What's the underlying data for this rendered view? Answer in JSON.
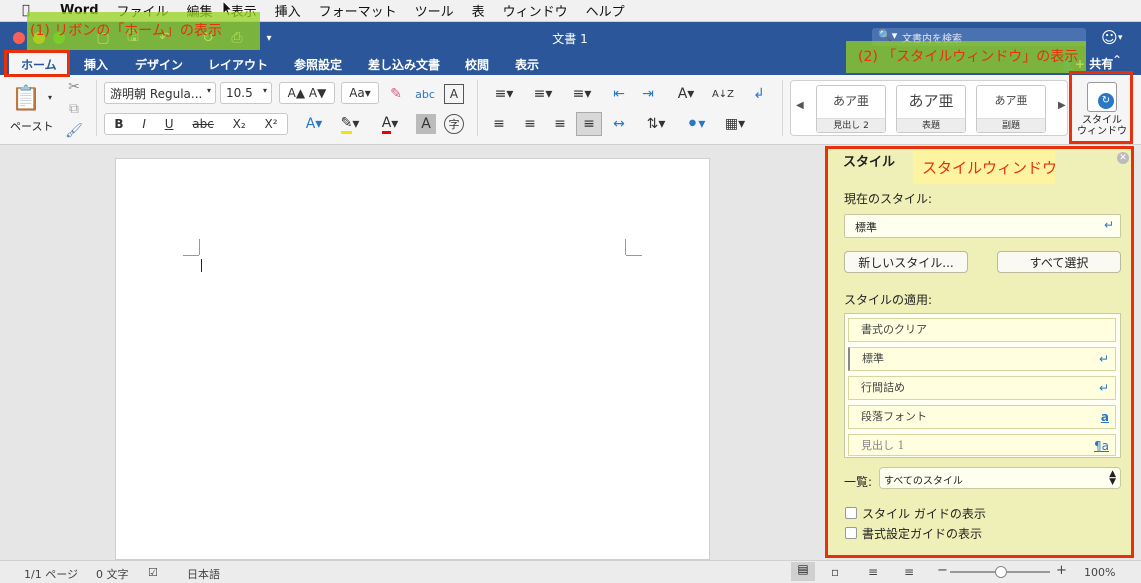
{
  "menubar": {
    "app_name": "Word",
    "items": [
      "ファイル",
      "編集",
      "表示",
      "挿入",
      "フォーマット",
      "ツール",
      "表",
      "ウィンドウ",
      "ヘルプ"
    ]
  },
  "titlebar": {
    "title": "文書 1",
    "search_placeholder": "文書内を検索"
  },
  "ribbon_tabs": [
    "ホーム",
    "挿入",
    "デザイン",
    "レイアウト",
    "参照設定",
    "差し込み文書",
    "校閲",
    "表示"
  ],
  "share_label": "共有",
  "ribbon": {
    "paste_label": "ペースト",
    "font_name": "游明朝 Regula...",
    "font_size": "10.5",
    "style_cards": [
      {
        "sample": "あア亜",
        "caption": "見出し 2"
      },
      {
        "sample": "あア亜",
        "caption": "表題"
      },
      {
        "sample": "あア亜",
        "caption": "副題"
      }
    ],
    "styles_window_label_1": "スタイル",
    "styles_window_label_2": "ウィンドウ"
  },
  "styles_pane": {
    "title": "スタイル",
    "current_style_label": "現在のスタイル:",
    "current_style_value": "標準",
    "new_style_button": "新しいスタイル...",
    "select_all_button": "すべて選択",
    "apply_label": "スタイルの適用:",
    "styles": [
      {
        "name": "書式のクリア",
        "mark": ""
      },
      {
        "name": "標準",
        "mark": "↵"
      },
      {
        "name": "行間詰め",
        "mark": "↵"
      },
      {
        "name": "段落フォント",
        "mark": "a"
      },
      {
        "name": "見出し 1",
        "mark": "¶a"
      }
    ],
    "list_label": "一覧:",
    "list_value": "すべてのスタイル",
    "show_style_guides": "スタイル ガイドの表示",
    "show_format_guides": "書式設定ガイドの表示"
  },
  "statusbar": {
    "page": "1/1 ページ",
    "words": "0 文字",
    "language": "日本語",
    "zoom": "100%"
  },
  "annotations": {
    "label_1": "(1) リボンの「ホーム」の表示",
    "label_2": "(2) 「スタイルウィンドウ」の表示",
    "label_3": "スタイルウィンドウ"
  },
  "colors": {
    "word_blue": "#2b579a",
    "annotation_red": "#e8300a",
    "highlight_green": "#96d21e",
    "pane_yellow": "#eef0b8"
  }
}
